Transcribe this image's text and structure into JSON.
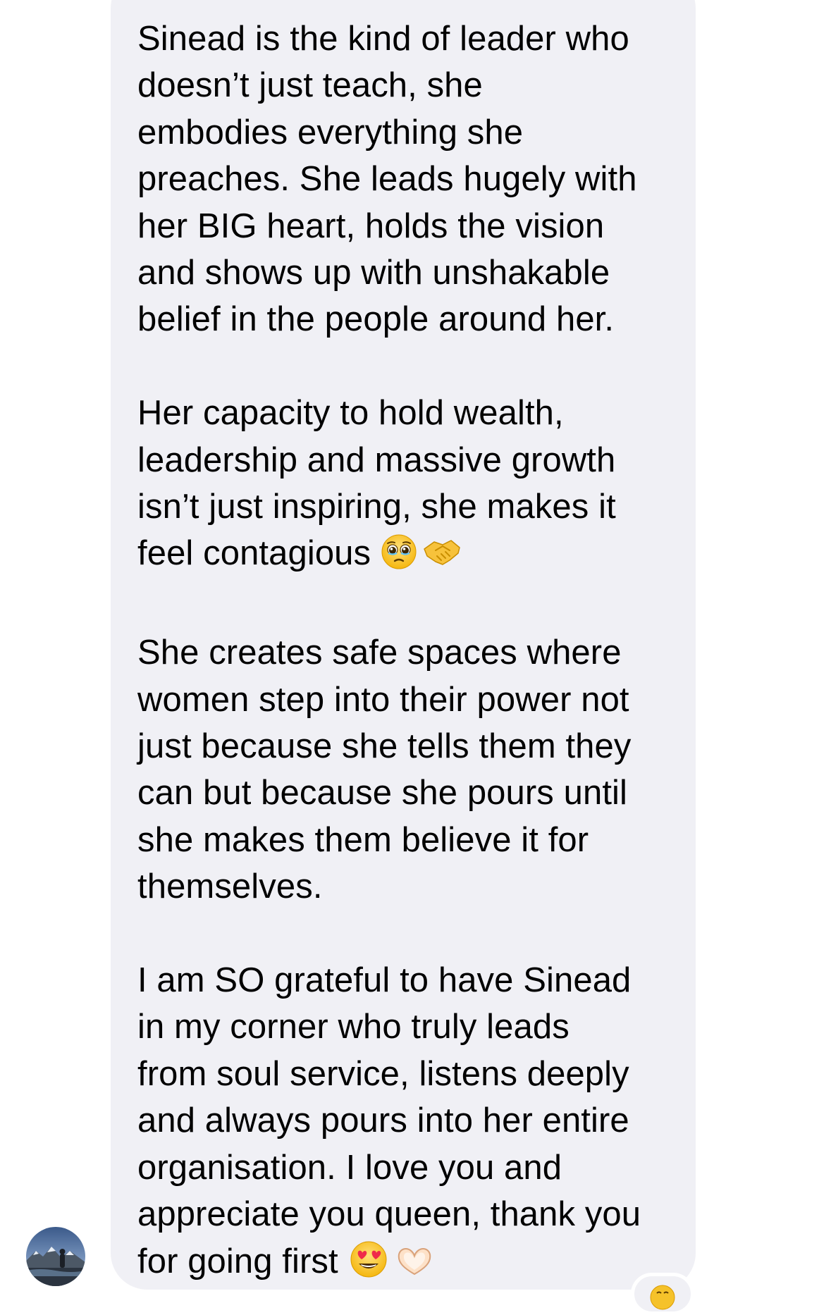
{
  "message": {
    "paragraphs": [
      {
        "lines": [
          "Sinead is the kind of leader who",
          "doesn’t just teach, she",
          "embodies everything she",
          "preaches. She leads hugely with",
          "her BIG heart, holds the vision",
          "and shows up with unshakable",
          "belief in the people around her."
        ]
      },
      {
        "lines": [
          "Her capacity to hold wealth,",
          "leadership and massive growth",
          "isn’t just inspiring, she makes it",
          "feel contagious"
        ],
        "emojis": [
          "pleading-face",
          "handshake"
        ]
      },
      {
        "lines": [
          "She creates safe spaces where",
          "women step into their power not",
          "just because she tells them they",
          "can but because she pours until",
          "she makes them believe it for",
          "themselves."
        ]
      },
      {
        "lines": [
          "I am SO grateful to have Sinead",
          "in my corner who truly leads",
          "from soul service, listens deeply",
          "and always pours into her entire",
          "organisation. I love you and",
          "appreciate you queen, thank you",
          "for going first"
        ],
        "emojis": [
          "heart-eyes-face",
          "heart-hands"
        ]
      }
    ]
  },
  "sender": {
    "avatar_icon": "avatar-photo-mountain-landscape"
  },
  "reaction": {
    "icon": "crying-face-icon"
  },
  "colors": {
    "background": "#ffffff",
    "bubble": "#f0f0f5",
    "text": "#000000"
  }
}
